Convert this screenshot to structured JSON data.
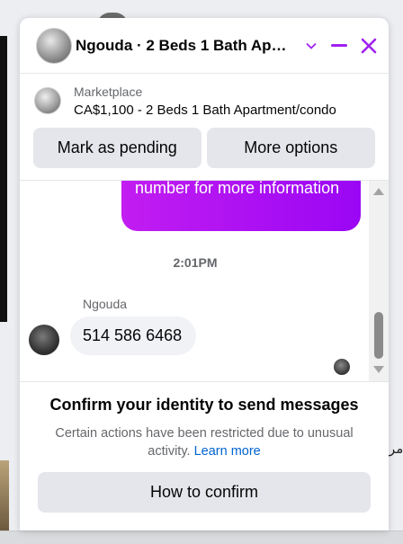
{
  "header": {
    "title": "Ngouda · 2 Beds 1 Bath Ap…",
    "accent_color": "#a020f0",
    "icons": [
      "chevron-down-icon",
      "minimize-icon",
      "close-icon"
    ]
  },
  "listing": {
    "label": "Marketplace",
    "title": "CA$1,100 - 2 Beds 1 Bath Apartment/condo"
  },
  "actions": {
    "pending_label": "Mark as pending",
    "more_label": "More options"
  },
  "thread": {
    "outgoing_text": "number for more information",
    "timestamp": "2:01PM",
    "sender_name": "Ngouda",
    "incoming_text": "514 586 6468"
  },
  "restriction": {
    "title": "Confirm your identity to send messages",
    "description": "Certain actions have been restricted due to unusual activity.",
    "link": "Learn more",
    "button_label": "How to confirm"
  },
  "background": {
    "side_text": "مر"
  }
}
